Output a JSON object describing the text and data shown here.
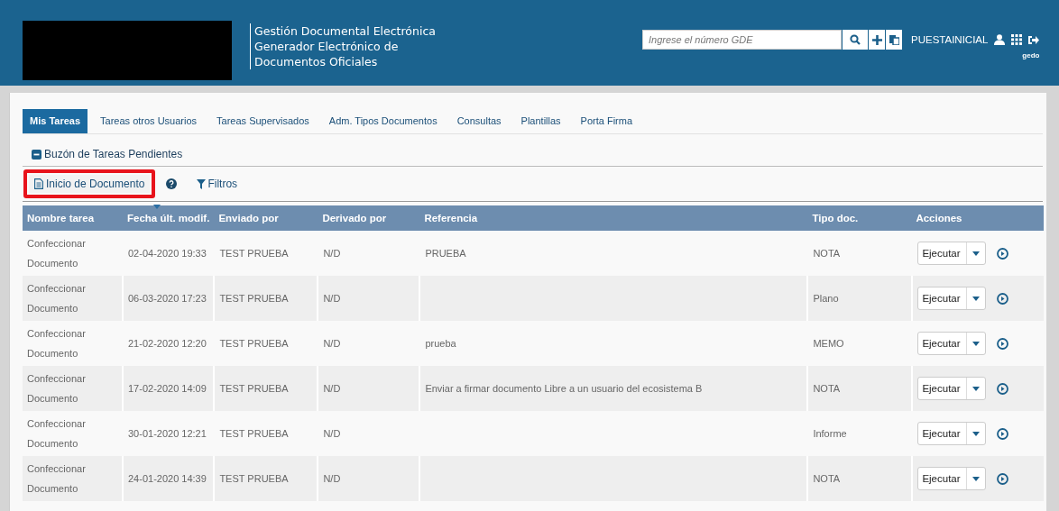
{
  "header": {
    "title_lines": [
      "Gestión Documental Electrónica",
      "Generador Electrónico de",
      "Documentos Oficiales"
    ],
    "search": {
      "placeholder": "Ingrese el número GDE"
    },
    "user": "PUESTAINICIAL",
    "module": "gedo"
  },
  "tabs": [
    {
      "label": "Mis Tareas",
      "selected": true
    },
    {
      "label": "Tareas otros Usuarios",
      "selected": false
    },
    {
      "label": "Tareas Supervisados",
      "selected": false
    },
    {
      "label": "Adm. Tipos Documentos",
      "selected": false
    },
    {
      "label": "Consultas",
      "selected": false
    },
    {
      "label": "Plantillas",
      "selected": false
    },
    {
      "label": "Porta Firma",
      "selected": false
    }
  ],
  "panel": {
    "title": "Buzón de Tareas Pendientes",
    "expanded": true
  },
  "toolbar": {
    "start_button": "Inicio de Documento",
    "highlighted": true,
    "filters": "Filtros"
  },
  "table": {
    "columns": [
      {
        "label": "Nombre tarea",
        "sorted": false
      },
      {
        "label": "Fecha últ. modif.",
        "sorted": true
      },
      {
        "label": "Enviado por",
        "sorted": false
      },
      {
        "label": "Derivado por",
        "sorted": false
      },
      {
        "label": "Referencia",
        "sorted": false
      },
      {
        "label": "Tipo doc.",
        "sorted": false
      },
      {
        "label": "Acciones",
        "sorted": false
      }
    ],
    "rows": [
      {
        "task": "Confeccionar Documento",
        "date": "02-04-2020 19:33",
        "sent_by": "TEST PRUEBA",
        "derived_by": "N/D",
        "reference": "PRUEBA",
        "doc_type": "NOTA",
        "action": "Ejecutar"
      },
      {
        "task": "Confeccionar Documento",
        "date": "06-03-2020 17:23",
        "sent_by": "TEST PRUEBA",
        "derived_by": "N/D",
        "reference": "",
        "doc_type": "Plano",
        "action": "Ejecutar"
      },
      {
        "task": "Confeccionar Documento",
        "date": "21-02-2020 12:20",
        "sent_by": "TEST PRUEBA",
        "derived_by": "N/D",
        "reference": "prueba",
        "doc_type": "MEMO",
        "action": "Ejecutar"
      },
      {
        "task": "Confeccionar Documento",
        "date": "17-02-2020 14:09",
        "sent_by": "TEST PRUEBA",
        "derived_by": "N/D",
        "reference": "Enviar a firmar documento Libre a un usuario del ecosistema B",
        "doc_type": "NOTA",
        "action": "Ejecutar"
      },
      {
        "task": "Confeccionar Documento",
        "date": "30-01-2020 12:21",
        "sent_by": "TEST PRUEBA",
        "derived_by": "N/D",
        "reference": "",
        "doc_type": "Informe",
        "action": "Ejecutar"
      },
      {
        "task": "Confeccionar Documento",
        "date": "24-01-2020 14:39",
        "sent_by": "TEST PRUEBA",
        "derived_by": "N/D",
        "reference": "",
        "doc_type": "NOTA",
        "action": "Ejecutar"
      }
    ]
  }
}
